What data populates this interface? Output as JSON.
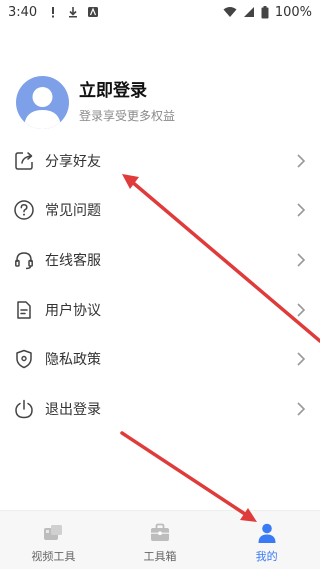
{
  "status_bar": {
    "time": "3:40",
    "battery": "100%",
    "left_icons": [
      "alert-icon",
      "download-icon",
      "app-notification-icon"
    ],
    "right_icons": [
      "wifi-icon",
      "signal-icon",
      "battery-icon"
    ]
  },
  "profile": {
    "title": "立即登录",
    "subtitle": "登录享受更多权益",
    "avatar_color": "#7ea0e8"
  },
  "menu": [
    {
      "label": "分享好友",
      "icon": "share-icon"
    },
    {
      "label": "常见问题",
      "icon": "question-icon"
    },
    {
      "label": "在线客服",
      "icon": "headset-icon"
    },
    {
      "label": "用户协议",
      "icon": "document-icon"
    },
    {
      "label": "隐私政策",
      "icon": "shield-icon"
    },
    {
      "label": "退出登录",
      "icon": "power-icon"
    }
  ],
  "tabs": [
    {
      "label": "视频工具",
      "icon": "video-tool-icon",
      "active": false
    },
    {
      "label": "工具箱",
      "icon": "toolbox-icon",
      "active": false
    },
    {
      "label": "我的",
      "icon": "user-icon",
      "active": true
    }
  ],
  "colors": {
    "accent": "#3a7bf5",
    "annotation_arrow": "#e03b3b",
    "tabbar_bg": "#f7f7f7"
  }
}
